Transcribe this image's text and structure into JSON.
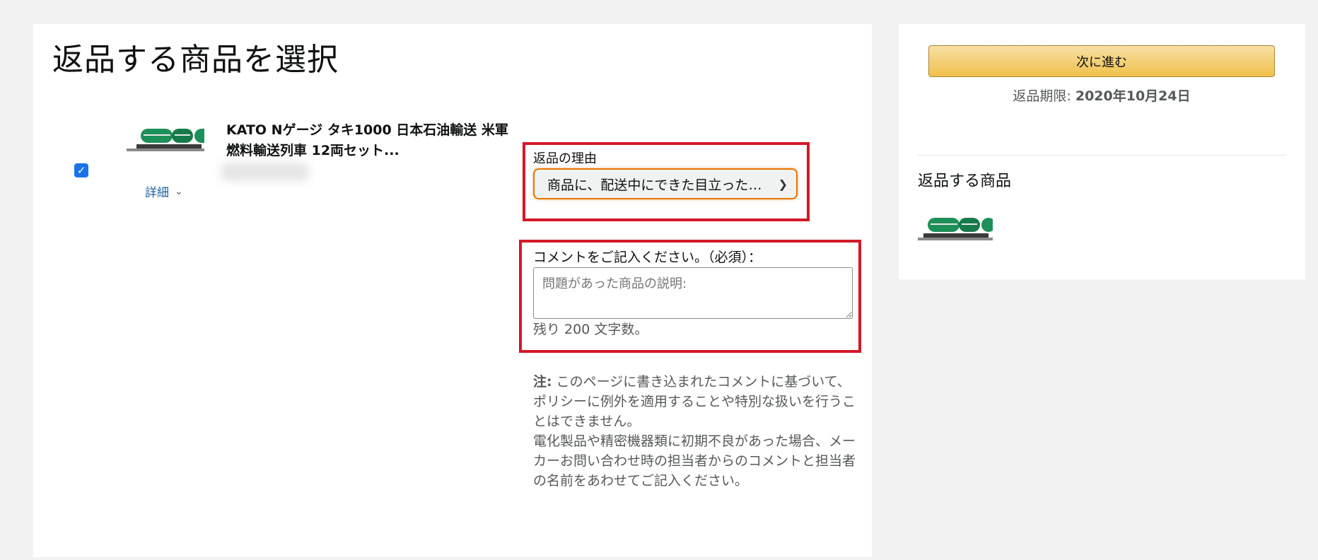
{
  "page": {
    "title": "返品する商品を選択"
  },
  "item": {
    "checked": true,
    "title": "KATO Nゲージ タキ1000 日本石油輸送 米軍燃料輸送列車 12両セット...",
    "details_label": "詳細"
  },
  "reason": {
    "label": "返品の理由",
    "selected": "商品に、配送中にできた目立った傷・汚れがある"
  },
  "comment": {
    "label": "コメントをご記入ください。（必須）：",
    "placeholder": "問題があった商品の説明:",
    "value": "",
    "remaining": "残り 200 文字数。"
  },
  "note": {
    "prefix": "注:",
    "line1": "このページに書き込まれたコメントに基づいて、ポリシーに例外を適用することや特別な扱いを行うことはできません。",
    "line2": "電化製品や精密機器類に初期不良があった場合、メーカーお問い合わせ時の担当者からのコメントと担当者の名前をあわせてご記入ください。"
  },
  "sidebar": {
    "next_button": "次に進む",
    "deadline_label": "返品期限:",
    "deadline_date": "2020年10月24日",
    "items_heading": "返品する商品"
  },
  "colors": {
    "highlight": "#d2182a",
    "button": "#f0c14b",
    "link": "#2162a1",
    "checkbox": "#1a73e8"
  },
  "icons": {
    "chevron": "chevron-down-icon",
    "check": "check-icon"
  }
}
